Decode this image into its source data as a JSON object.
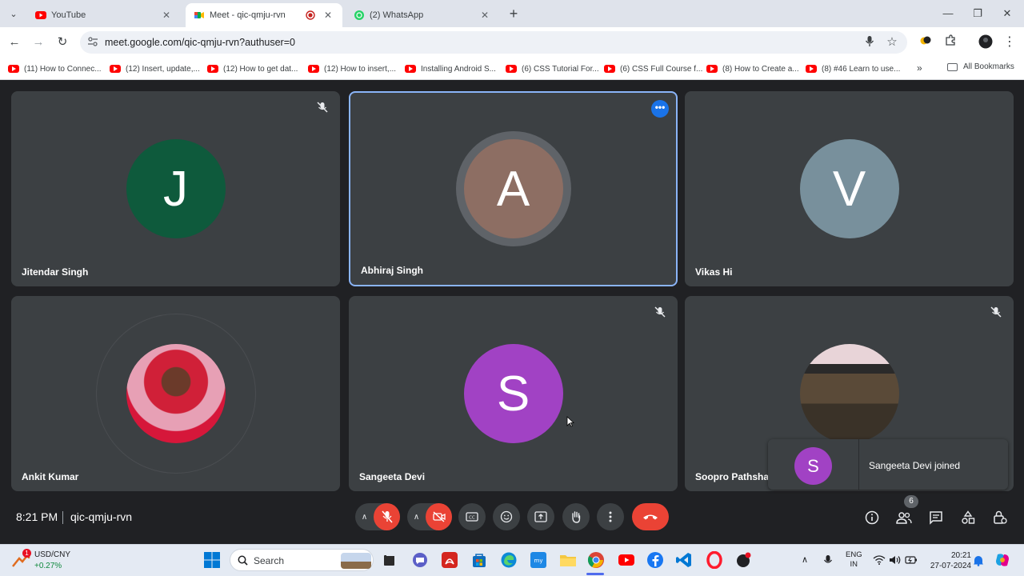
{
  "browser": {
    "tabs": [
      {
        "title": "YouTube",
        "active": false
      },
      {
        "title": "Meet - qic-qmju-rvn",
        "active": true
      },
      {
        "title": "(2) WhatsApp",
        "active": false
      }
    ],
    "url": "meet.google.com/qic-qmju-rvn?authuser=0",
    "bookmarks": [
      "(11) How to Connec...",
      "(12) Insert, update,...",
      "(12) How to get dat...",
      "(12) How to insert,...",
      "Installing Android S...",
      "(6) CSS Tutorial For...",
      "(6) CSS Full Course f...",
      "(8) How to Create a...",
      "(8) #46 Learn to use..."
    ],
    "all_bookmarks": "All Bookmarks",
    "more_bookmarks": "»"
  },
  "meet": {
    "participants": [
      {
        "name": "Jitendar Singh",
        "initial": "J",
        "color": "#0e5a3c",
        "muted": true,
        "speaking": false
      },
      {
        "name": "Abhiraj Singh",
        "initial": "A",
        "color": "#8d6e63",
        "muted": false,
        "speaking": true
      },
      {
        "name": "Vikas Hi",
        "initial": "V",
        "color": "#78909c",
        "muted": false,
        "speaking": false
      },
      {
        "name": "Ankit Kumar",
        "initial": "",
        "color": "",
        "muted": false,
        "speaking": false
      },
      {
        "name": "Sangeeta Devi",
        "initial": "S",
        "color": "#a142c4",
        "muted": true,
        "speaking": false
      },
      {
        "name": "Soopro Pathshal",
        "initial": "",
        "color": "",
        "muted": true,
        "speaking": false
      }
    ],
    "toast": {
      "initial": "S",
      "text": "Sangeeta Devi joined"
    },
    "time": "8:21 PM",
    "meeting_code": "qic-qmju-rvn",
    "people_count": "6",
    "colors": {
      "mic_off": "#ea4335",
      "hangup": "#ea4335",
      "speaking_border": "#8ab4f8"
    }
  },
  "taskbar": {
    "weather_line1": "USD/CNY",
    "weather_line2": "+0.27%",
    "weather_badge": "1",
    "search_label": "Search",
    "lang_line1": "ENG",
    "lang_line2": "IN",
    "time": "20:21",
    "date": "27-07-2024"
  }
}
